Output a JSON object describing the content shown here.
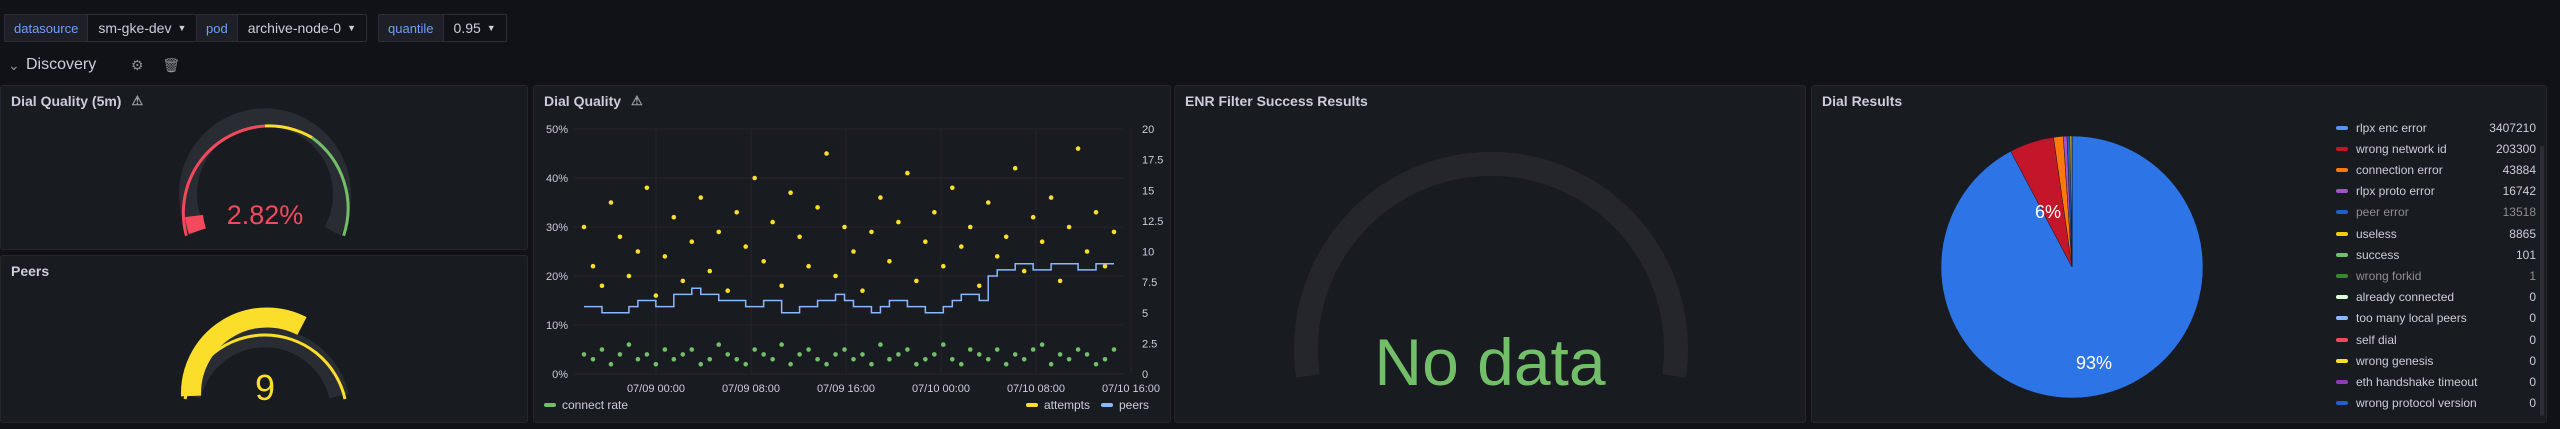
{
  "variables": [
    {
      "label": "datasource",
      "value": "sm-gke-dev"
    },
    {
      "label": "pod",
      "value": "archive-node-0"
    },
    {
      "label": "quantile",
      "value": "0.95"
    }
  ],
  "row": {
    "title": "Discovery"
  },
  "panels": {
    "dial_quality_5m": {
      "title": "Dial Quality (5m)",
      "value": "2.82%",
      "fraction": 0.0282,
      "color": "#f2495c"
    },
    "peers": {
      "title": "Peers",
      "value": "9",
      "color": "#fade2a"
    },
    "dial_quality": {
      "title": "Dial Quality"
    },
    "enr_filter": {
      "title": "ENR Filter Success Results",
      "no_data": "No data"
    },
    "dial_results": {
      "title": "Dial Results"
    }
  },
  "colors": {
    "attempts": "#fade2a",
    "connect_rate": "#73bf69",
    "peers": "#8ab8ff",
    "pie_main": "#1f60c4"
  },
  "chart_data": [
    {
      "type": "scatter",
      "title": "Dial Quality",
      "x_tick_labels": [
        "07/09 00:00",
        "07/09 08:00",
        "07/09 16:00",
        "07/10 00:00",
        "07/10 08:00",
        "07/10 16:00"
      ],
      "y_left_tick_labels": [
        "0%",
        "10%",
        "20%",
        "30%",
        "40%",
        "50%"
      ],
      "y_right_tick_labels": [
        "0",
        "2.5",
        "5",
        "7.5",
        "10",
        "12.5",
        "15",
        "17.5",
        "20"
      ],
      "ylim_left": [
        0,
        50
      ],
      "ylim_right": [
        0,
        20
      ],
      "legend_position": "bottom",
      "series": [
        {
          "name": "connect rate",
          "axis": "left",
          "kind": "scatter",
          "values": [
            4,
            3,
            5,
            2,
            4,
            6,
            3,
            4,
            2,
            5,
            3,
            4,
            5,
            2,
            3,
            6,
            4,
            3,
            2,
            5,
            4,
            3,
            6,
            2,
            4,
            5,
            3,
            2,
            4,
            5,
            3,
            4,
            2,
            6,
            3,
            4,
            5,
            2,
            3,
            4,
            6,
            3,
            2,
            5,
            4,
            3,
            5,
            2,
            4,
            3,
            5,
            6,
            2,
            4,
            3,
            5,
            4,
            2,
            3,
            5
          ]
        },
        {
          "name": "attempts",
          "axis": "left",
          "kind": "scatter",
          "values": [
            30,
            22,
            18,
            35,
            28,
            20,
            25,
            38,
            16,
            24,
            32,
            19,
            27,
            36,
            21,
            29,
            17,
            33,
            26,
            40,
            23,
            31,
            18,
            37,
            28,
            22,
            34,
            45,
            20,
            30,
            25,
            17,
            29,
            36,
            23,
            31,
            41,
            19,
            27,
            33,
            22,
            38,
            26,
            30,
            18,
            35,
            24,
            28,
            42,
            21,
            32,
            27,
            36,
            19,
            30,
            46,
            25,
            33,
            22,
            29
          ]
        },
        {
          "name": "peers",
          "axis": "right",
          "kind": "step",
          "values": [
            5.5,
            5.5,
            5,
            5,
            5,
            5.5,
            6,
            6,
            5.5,
            5.5,
            6.5,
            6.5,
            7,
            6.5,
            6.5,
            6,
            6,
            6,
            5.5,
            5.5,
            6,
            6,
            5,
            5,
            5.5,
            5.5,
            6,
            6,
            6.5,
            6,
            5.5,
            5.5,
            5,
            5.5,
            6,
            6,
            5.5,
            5.5,
            5,
            5,
            5.5,
            6,
            6.5,
            6.5,
            6,
            8,
            8.5,
            8.5,
            9,
            9,
            8.5,
            8.5,
            9,
            9,
            9,
            8.5,
            8.5,
            9,
            9,
            9
          ]
        }
      ]
    },
    {
      "type": "pie",
      "title": "Dial Results",
      "slice_labels": [
        "93%",
        "6%"
      ],
      "legend_position": "right",
      "series": [
        {
          "name": "rlpx enc error",
          "value": 3407210,
          "display": "3407210",
          "color": "#5794f2"
        },
        {
          "name": "wrong network id",
          "value": 203300,
          "display": "203300",
          "color": "#c4162a"
        },
        {
          "name": "connection error",
          "value": 43884,
          "display": "43884",
          "color": "#ff780a"
        },
        {
          "name": "rlpx proto error",
          "value": 16742,
          "display": "16742",
          "color": "#a352cc"
        },
        {
          "name": "peer error",
          "value": 13518,
          "display": "13518",
          "color": "#1f60c4",
          "dim": true
        },
        {
          "name": "useless",
          "value": 8865,
          "display": "8865",
          "color": "#f2cc0c"
        },
        {
          "name": "success",
          "value": 101,
          "display": "101",
          "color": "#73bf69"
        },
        {
          "name": "wrong forkid",
          "value": 1,
          "display": "1",
          "color": "#37872d",
          "dim": true
        },
        {
          "name": "already connected",
          "value": 0,
          "display": "0",
          "color": "#e0f9d7"
        },
        {
          "name": "too many local peers",
          "value": 0,
          "display": "0",
          "color": "#8ab8ff"
        },
        {
          "name": "self dial",
          "value": 0,
          "display": "0",
          "color": "#f2495c"
        },
        {
          "name": "wrong genesis",
          "value": 0,
          "display": "0",
          "color": "#fade2a"
        },
        {
          "name": "eth handshake timeout",
          "value": 0,
          "display": "0",
          "color": "#8f3bb8"
        },
        {
          "name": "wrong protocol version",
          "value": 0,
          "display": "0",
          "color": "#1f60c4"
        }
      ]
    }
  ]
}
